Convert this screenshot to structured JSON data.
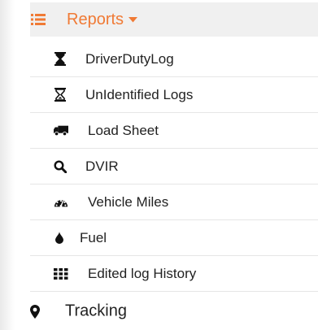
{
  "menu": {
    "reports": {
      "label": "Reports",
      "icon": "list-icon",
      "accent_color": "#f07a35"
    },
    "sub_items": [
      {
        "label": "DriverDutyLog",
        "icon": "hourglass-filled-icon"
      },
      {
        "label": "UnIdentified Logs",
        "icon": "hourglass-icon"
      },
      {
        "label": "Load Sheet",
        "icon": "truck-icon"
      },
      {
        "label": "DVIR",
        "icon": "search-icon"
      },
      {
        "label": "Vehicle Miles",
        "icon": "tachometer-icon"
      },
      {
        "label": "Fuel",
        "icon": "drop-icon"
      },
      {
        "label": "Edited log History",
        "icon": "grid-icon"
      }
    ],
    "tracking": {
      "label": "Tracking",
      "icon": "map-marker-icon"
    }
  }
}
